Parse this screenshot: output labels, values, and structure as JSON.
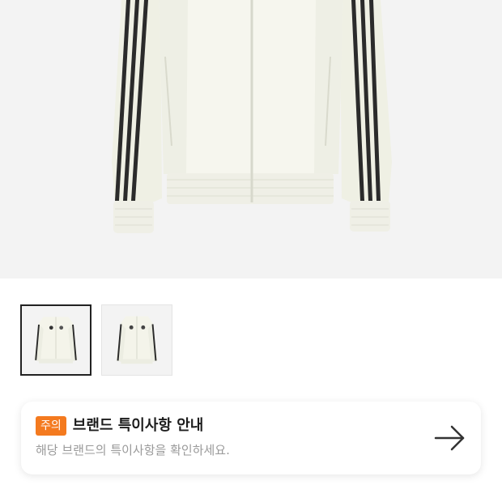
{
  "product": {
    "main_image": "track-jacket-white-photo",
    "thumbnails": [
      {
        "name": "track-jacket-white-front",
        "selected": true
      },
      {
        "name": "track-jacket-white-front-alt",
        "selected": false
      }
    ]
  },
  "notice": {
    "badge": "주의",
    "title": "브랜드 특이사항 안내",
    "description": "해당 브랜드의 특이사항을 확인하세요.",
    "arrow_icon": "arrow-right-icon",
    "badge_color": "#f47a1f"
  }
}
